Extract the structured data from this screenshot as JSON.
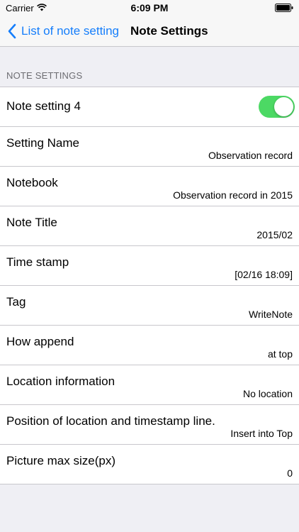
{
  "status_bar": {
    "carrier": "Carrier",
    "time": "6:09 PM"
  },
  "nav": {
    "back_label": "List of note setting",
    "title": "Note Settings"
  },
  "section": {
    "header": "NOTE SETTINGS"
  },
  "toggle_row": {
    "label": "Note setting 4",
    "on": true
  },
  "rows": [
    {
      "label": "Setting Name",
      "value": "Observation record"
    },
    {
      "label": "Notebook",
      "value": "Observation record in 2015"
    },
    {
      "label": "Note Title",
      "value": "2015/02"
    },
    {
      "label": "Time stamp",
      "value": "[02/16 18:09]"
    },
    {
      "label": "Tag",
      "value": "WriteNote"
    },
    {
      "label": "How append",
      "value": "at top"
    },
    {
      "label": "Location information",
      "value": "No location"
    },
    {
      "label": "Position of location and timestamp line.",
      "value": "Insert into Top"
    },
    {
      "label": "Picture max size(px)",
      "value": "0"
    }
  ],
  "colors": {
    "accent": "#157efb",
    "switch_on": "#4cd964",
    "background": "#efeff4"
  },
  "icons": {
    "back": "chevron-left-icon",
    "wifi": "wifi-icon",
    "battery": "battery-icon"
  }
}
